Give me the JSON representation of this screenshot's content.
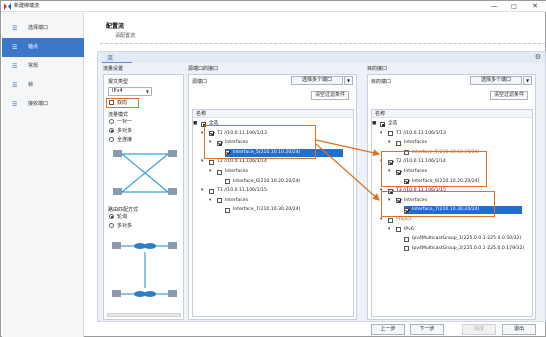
{
  "window": {
    "title": "新建绑端流",
    "controls": [
      "—",
      "□",
      "✕"
    ]
  },
  "sidebar": {
    "items": [
      {
        "label": "选择端口",
        "active": false
      },
      {
        "label": "轴点",
        "active": true
      },
      {
        "label": "常规",
        "active": false
      },
      {
        "label": "帧",
        "active": false
      },
      {
        "label": "接收端口",
        "active": false
      }
    ]
  },
  "header": {
    "title": "配置流",
    "subtitle": "请配置流"
  },
  "flow": {
    "name": "流",
    "settings_title": "流量设置",
    "protocol_label": "报文类型",
    "protocol_value": "IPv4",
    "bidirectional_label": "双向",
    "mapping_title": "流量模式",
    "mapping_options": [
      "一对一",
      "多对多",
      "全连接"
    ],
    "mapping_selected": 1,
    "route_title": "路由匹配方式",
    "route_options": [
      "轮询",
      "多对多"
    ],
    "route_selected": 0,
    "source": {
      "title": "源端口的接口",
      "select_btn": "选择多个端口",
      "filter_btn": "清空过滤条件",
      "col": "名称",
      "nodes": [
        {
          "label": "全选",
          "level": 0,
          "check": "partial",
          "toggle": "▣"
        },
        {
          "label": "T1 //10.0.11.106/1/13",
          "level": 1,
          "check": "checked",
          "toggle": "▼"
        },
        {
          "label": "Interfaces",
          "level": 2,
          "check": "checked",
          "toggle": "▼"
        },
        {
          "label": "Interface_5(210.10.10.20/24)",
          "level": 3,
          "check": "checked",
          "toggle": "",
          "hl": true
        },
        {
          "label": "T2 //10.0.11.106/1/14",
          "level": 1,
          "check": "",
          "toggle": "▼"
        },
        {
          "label": "Interfaces",
          "level": 2,
          "check": "",
          "toggle": "▼"
        },
        {
          "label": "Interface_6(210.10.20.20/24)",
          "level": 3,
          "check": "",
          "toggle": ""
        },
        {
          "label": "T3 //10.0.11.106/1/15",
          "level": 1,
          "check": "",
          "toggle": "▼"
        },
        {
          "label": "Interfaces",
          "level": 2,
          "check": "",
          "toggle": "▼"
        },
        {
          "label": "Interface_7(210.10.30.20/24)",
          "level": 3,
          "check": "",
          "toggle": ""
        }
      ]
    },
    "dest": {
      "title": "目的接口",
      "select_btn": "选择多个端口",
      "filter_btn": "清空过滤条件",
      "col": "名称",
      "nodes": [
        {
          "label": "全选",
          "level": 0,
          "check": "partial",
          "toggle": "▣"
        },
        {
          "label": "T1 //10.0.11.106/1/13",
          "level": 1,
          "check": "",
          "toggle": "▼"
        },
        {
          "label": "Interfaces",
          "level": 2,
          "check": "",
          "toggle": "▼"
        },
        {
          "label": "Interface_5(210.10.10.20/24)",
          "level": 3,
          "check": "",
          "toggle": "",
          "dim": true
        },
        {
          "label": "T2 //10.0.11.106/1/14",
          "level": 1,
          "check": "checked",
          "toggle": "▼"
        },
        {
          "label": "Interfaces",
          "level": 2,
          "check": "checked",
          "toggle": "▼"
        },
        {
          "label": "Interface_6(210.10.20.20/24)",
          "level": 3,
          "check": "checked",
          "toggle": ""
        },
        {
          "label": "T3 //10.0.11.106/1/15",
          "level": 1,
          "check": "checked",
          "toggle": "▼"
        },
        {
          "label": "Interfaces",
          "level": 2,
          "check": "checked",
          "toggle": "▼"
        },
        {
          "label": "Interface_7(210.10.30.20/24)",
          "level": 3,
          "check": "checked",
          "toggle": "",
          "hl": true
        },
        {
          "label": "Project",
          "level": 1,
          "check": "",
          "toggle": "▼",
          "dim": true
        },
        {
          "label": "IPv6",
          "level": 2,
          "check": "",
          "toggle": "▼"
        },
        {
          "label": "Ipv4MulticastGroup_1(225.0.0.1-225.0.0.50/32)",
          "level": 3,
          "check": "",
          "toggle": ""
        },
        {
          "label": "Ipv4MulticastGroup_2(225.0.0.1-225.0.0.179/32)",
          "level": 3,
          "check": "",
          "toggle": ""
        }
      ]
    }
  },
  "footer": {
    "prev": "上一步",
    "next": "下一步",
    "finish": "完成",
    "exit": "退出"
  }
}
